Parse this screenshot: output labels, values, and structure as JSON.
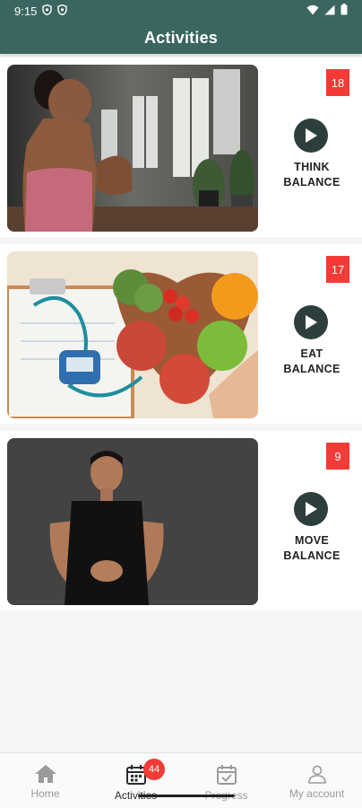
{
  "status_bar": {
    "time": "9:15",
    "left_icons": [
      "shield-icon",
      "shield-icon"
    ],
    "right_icons": [
      "wifi-icon",
      "signal-icon",
      "battery-icon"
    ]
  },
  "app_bar": {
    "title": "Activities"
  },
  "activities": [
    {
      "count": "18",
      "label": "THINK\nBALANCE",
      "image": "meditation-photo"
    },
    {
      "count": "17",
      "label": "EAT\nBALANCE",
      "image": "healthy-food-photo"
    },
    {
      "count": "9",
      "label": "MOVE\nBALANCE",
      "image": "fitness-man-photo"
    }
  ],
  "bottom_nav": {
    "items": [
      {
        "label": "Home",
        "icon": "home-icon",
        "active": false
      },
      {
        "label": "Activities",
        "icon": "calendar-icon",
        "active": true,
        "badge": "44"
      },
      {
        "label": "Progress",
        "icon": "calendar-check-icon",
        "active": false
      },
      {
        "label": "My account",
        "icon": "person-icon",
        "active": false
      }
    ]
  },
  "colors": {
    "header": "#3b6660",
    "badge": "#f43a36",
    "play_button": "#2c3f3d"
  }
}
